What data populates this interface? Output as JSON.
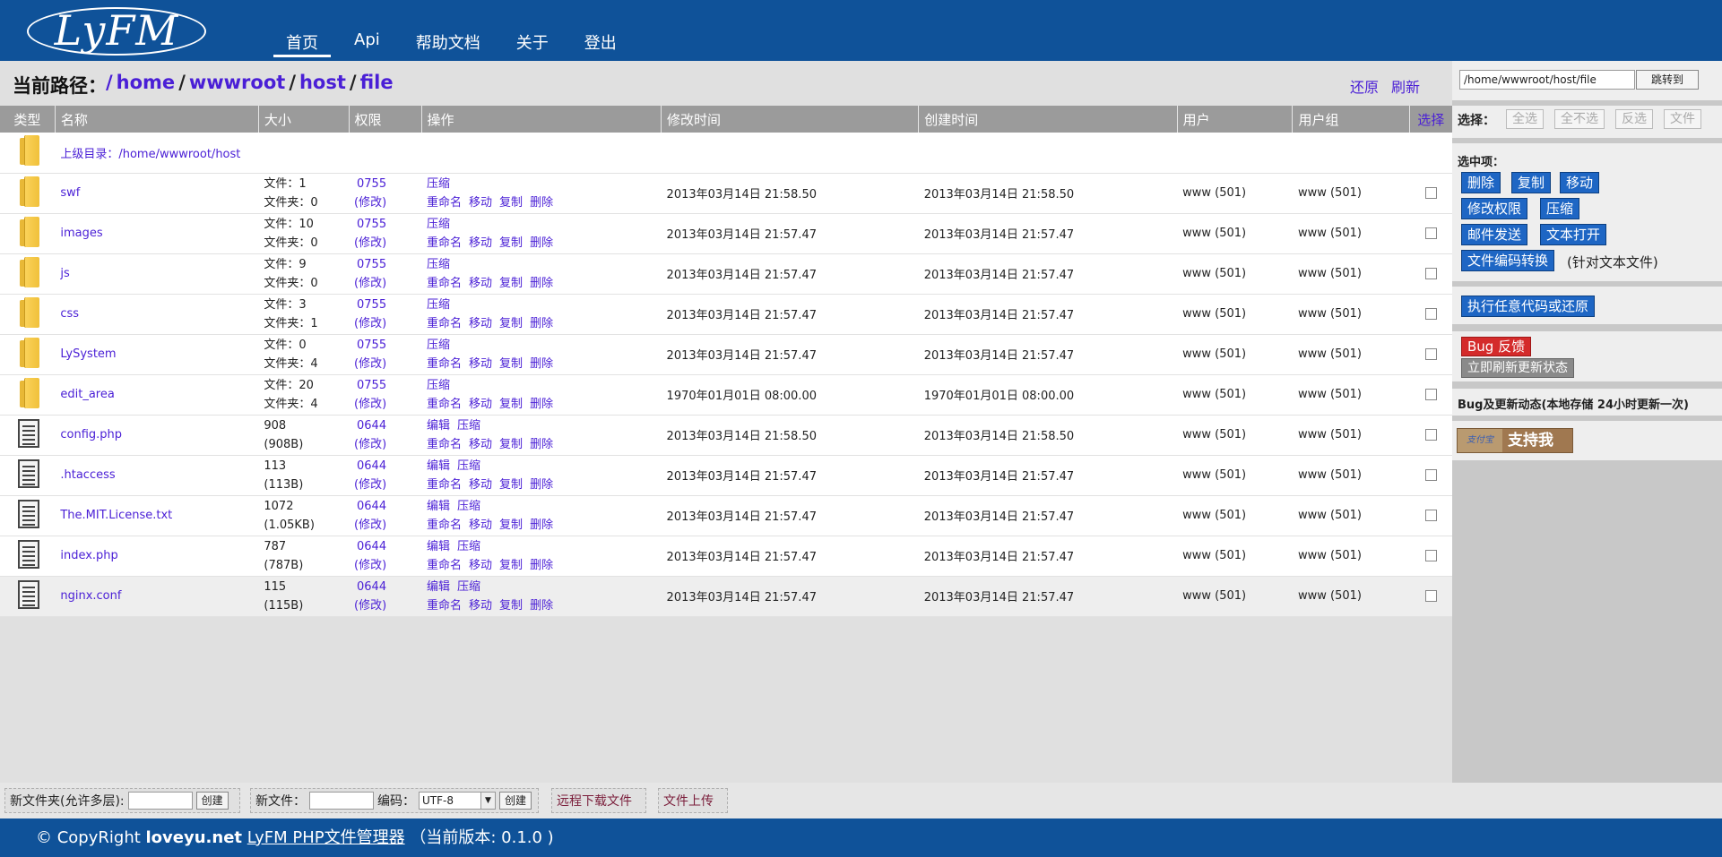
{
  "app": {
    "logo": "LyFM"
  },
  "nav": [
    {
      "label": "首页",
      "active": true
    },
    {
      "label": "Api"
    },
    {
      "label": "帮助文档"
    },
    {
      "label": "关于"
    },
    {
      "label": "登出"
    }
  ],
  "path": {
    "label": "当前路径：",
    "segments": [
      "home",
      "wwwroot",
      "host",
      "file"
    ],
    "restore": "还原",
    "refresh": "刷新"
  },
  "table": {
    "headers": {
      "type": "类型",
      "name": "名称",
      "size": "大小",
      "perm": "权限",
      "ops": "操作",
      "mtime": "修改时间",
      "ctime": "创建时间",
      "user": "用户",
      "group": "用户组",
      "select": "选择"
    },
    "parent": "上级目录：/home/wwwroot/host",
    "ops": {
      "compress": "压缩",
      "rename": "重命名",
      "move": "移动",
      "copy": "复制",
      "delete": "删除",
      "edit": "编辑"
    },
    "rows": [
      {
        "kind": "folder",
        "name": "swf",
        "size1": "文件：1",
        "size2": "文件夹：0",
        "perm": "0755",
        "mod": "(修改)",
        "mtime": "2013年03月14日 21:58.50",
        "ctime": "2013年03月14日 21:58.50",
        "user": "www (501)",
        "group": "www (501)"
      },
      {
        "kind": "folder",
        "name": "images",
        "size1": "文件：10",
        "size2": "文件夹：0",
        "perm": "0755",
        "mod": "(修改)",
        "mtime": "2013年03月14日 21:57.47",
        "ctime": "2013年03月14日 21:57.47",
        "user": "www (501)",
        "group": "www (501)"
      },
      {
        "kind": "folder",
        "name": "js",
        "size1": "文件：9",
        "size2": "文件夹：0",
        "perm": "0755",
        "mod": "(修改)",
        "mtime": "2013年03月14日 21:57.47",
        "ctime": "2013年03月14日 21:57.47",
        "user": "www (501)",
        "group": "www (501)"
      },
      {
        "kind": "folder",
        "name": "css",
        "size1": "文件：3",
        "size2": "文件夹：1",
        "perm": "0755",
        "mod": "(修改)",
        "mtime": "2013年03月14日 21:57.47",
        "ctime": "2013年03月14日 21:57.47",
        "user": "www (501)",
        "group": "www (501)"
      },
      {
        "kind": "folder",
        "name": "LySystem",
        "size1": "文件：0",
        "size2": "文件夹：4",
        "perm": "0755",
        "mod": "(修改)",
        "mtime": "2013年03月14日 21:57.47",
        "ctime": "2013年03月14日 21:57.47",
        "user": "www (501)",
        "group": "www (501)"
      },
      {
        "kind": "folder",
        "name": "edit_area",
        "size1": "文件：20",
        "size2": "文件夹：4",
        "perm": "0755",
        "mod": "(修改)",
        "mtime": "1970年01月01日 08:00.00",
        "ctime": "1970年01月01日 08:00.00",
        "user": "www (501)",
        "group": "www (501)"
      },
      {
        "kind": "file",
        "name": "config.php",
        "size1": "908",
        "size2": "(908B)",
        "perm": "0644",
        "mod": "(修改)",
        "mtime": "2013年03月14日 21:58.50",
        "ctime": "2013年03月14日 21:58.50",
        "user": "www (501)",
        "group": "www (501)"
      },
      {
        "kind": "file",
        "name": ".htaccess",
        "size1": "113",
        "size2": "(113B)",
        "perm": "0644",
        "mod": "(修改)",
        "mtime": "2013年03月14日 21:57.47",
        "ctime": "2013年03月14日 21:57.47",
        "user": "www (501)",
        "group": "www (501)"
      },
      {
        "kind": "file",
        "name": "The.MIT.License.txt",
        "size1": "1072",
        "size2": "(1.05KB)",
        "perm": "0644",
        "mod": "(修改)",
        "mtime": "2013年03月14日 21:57.47",
        "ctime": "2013年03月14日 21:57.47",
        "user": "www (501)",
        "group": "www (501)"
      },
      {
        "kind": "file",
        "name": "index.php",
        "size1": "787",
        "size2": "(787B)",
        "perm": "0644",
        "mod": "(修改)",
        "mtime": "2013年03月14日 21:57.47",
        "ctime": "2013年03月14日 21:57.47",
        "user": "www (501)",
        "group": "www (501)"
      },
      {
        "kind": "file",
        "name": "nginx.conf",
        "size1": "115",
        "size2": "(115B)",
        "perm": "0644",
        "mod": "(修改)",
        "mtime": "2013年03月14日 21:57.47",
        "ctime": "2013年03月14日 21:57.47",
        "user": "www (501)",
        "group": "www (501)"
      }
    ]
  },
  "sidebar": {
    "jump_value": "/home/wwwroot/host/file",
    "jump_button": "跳转到",
    "select_label": "选择：",
    "select_buttons": [
      "全选",
      "全不选",
      "反选",
      "文件"
    ],
    "selected_heading": "选中项：",
    "delete": "删除",
    "copy": "复制",
    "move": "移动",
    "chmod": "修改权限",
    "compress": "压缩",
    "mail": "邮件发送",
    "text_open": "文本打开",
    "encode": "文件编码转换",
    "encode_note": "(针对文本文件)",
    "exec": "执行任意代码或还原",
    "bug": "Bug 反馈",
    "refresh_status": "立即刷新更新状态",
    "update_note": "Bug及更新动态(本地存储 24小时更新一次)",
    "support_logo": "支付宝",
    "support": "支持我"
  },
  "toolbar": {
    "new_folder_label": "新文件夹(允许多层):",
    "create": "创建",
    "new_file_label": "新文件：",
    "encoding_label": "编码：",
    "encoding_value": "UTF-8",
    "remote_download": "远程下载文件",
    "upload": "文件上传"
  },
  "footer": {
    "copyright": "© CopyRight ",
    "site": "loveyu.net",
    "product": "LyFM PHP文件管理器",
    "version": "（当前版本: 0.1.0 )"
  }
}
